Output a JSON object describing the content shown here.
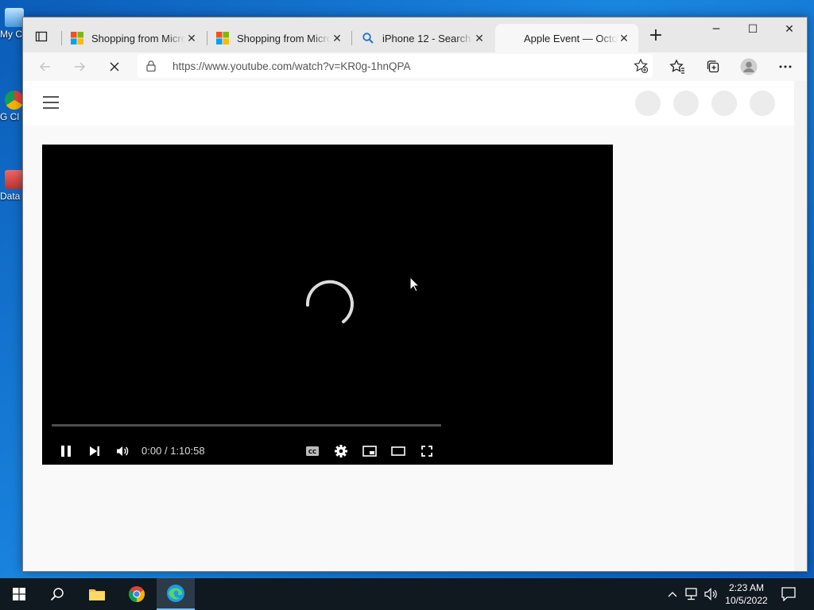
{
  "desktop": {
    "icons": [
      {
        "label": "My C",
        "icon": "computer-icon"
      },
      {
        "label": "G Cl",
        "icon": "chrome-shortcut-icon"
      },
      {
        "label": "Data",
        "icon": "data-shortcut-icon"
      }
    ]
  },
  "browser": {
    "tabs": [
      {
        "title": "Shopping from Microsoft",
        "icon": "microsoft-logo-icon"
      },
      {
        "title": "Shopping from Microsoft",
        "icon": "microsoft-logo-icon"
      },
      {
        "title": "iPhone 12 - Search",
        "icon": "search-icon"
      },
      {
        "title": "Apple Event — October",
        "icon": "loading-icon"
      }
    ],
    "new_tab": "+",
    "window_controls": {
      "minimize": "─",
      "maximize": "☐",
      "close": "✕"
    },
    "address_url": "https://www.youtube.com/watch?v=KR0g-1hnQPA"
  },
  "player": {
    "time_current": "0:00",
    "time_separator": "/",
    "time_total": "1:10:58",
    "progress_fraction": 0.0
  },
  "taskbar": {
    "time": "2:23 AM",
    "date": "10/5/2022"
  },
  "colors": {
    "accent": "#0078d4",
    "progress_red": "#ff0000",
    "taskbar": "#101820"
  }
}
